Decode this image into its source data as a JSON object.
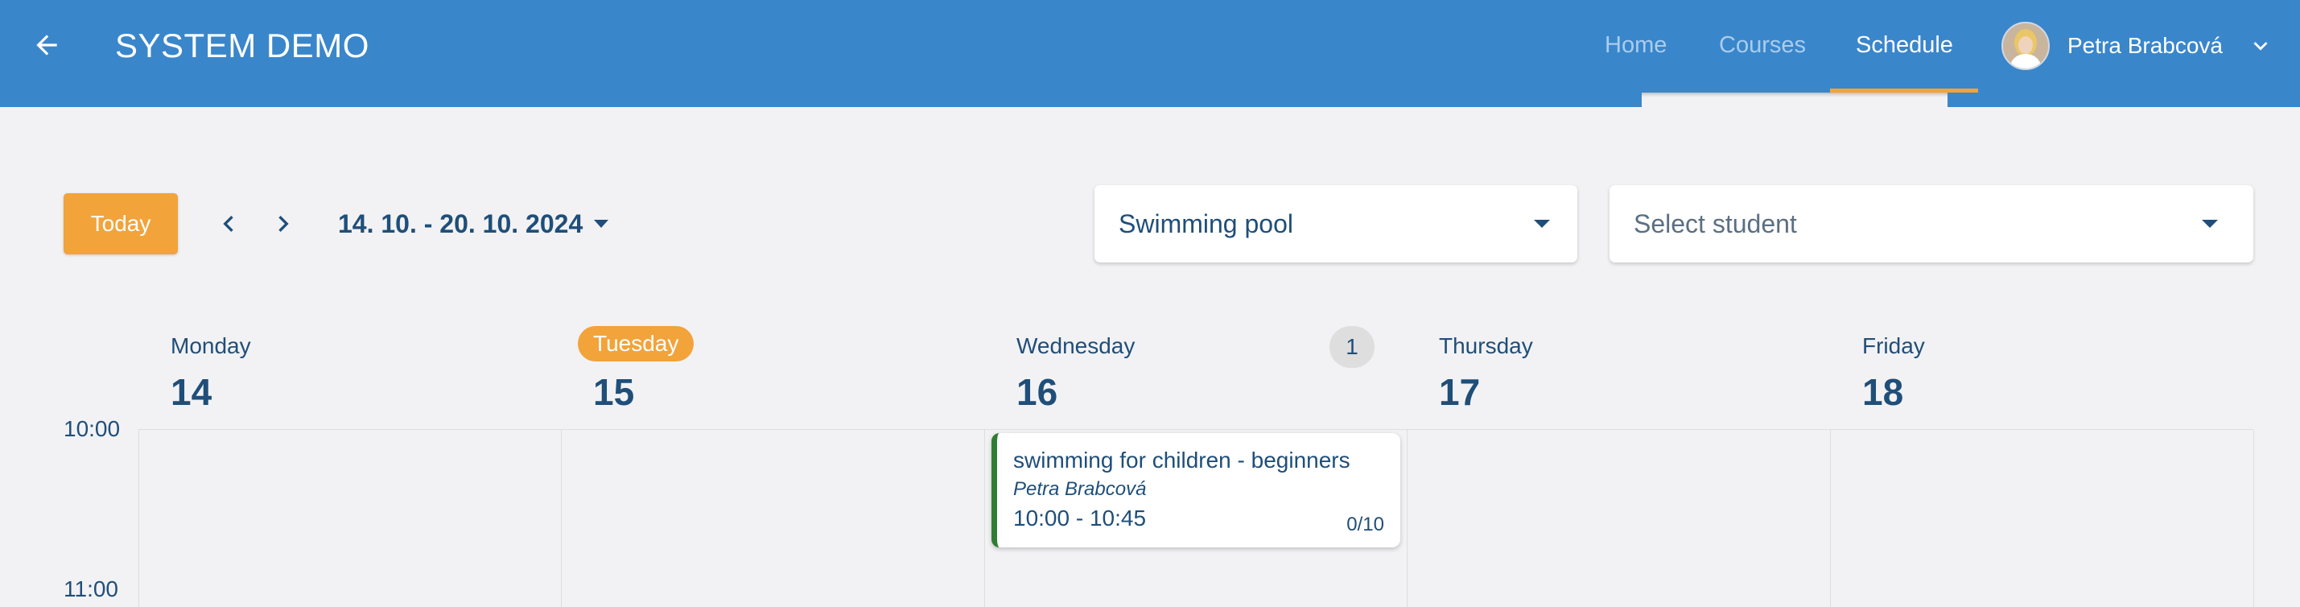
{
  "header": {
    "app_title": "SYSTEM DEMO",
    "nav": [
      {
        "label": "Home"
      },
      {
        "label": "Courses"
      },
      {
        "label": "Schedule"
      }
    ],
    "active_nav": "Schedule",
    "user_name": "Petra Brabcová"
  },
  "toolbar": {
    "today_label": "Today",
    "date_range": "14. 10. - 20. 10. 2024",
    "location_select": {
      "value": "Swimming pool"
    },
    "student_select": {
      "placeholder": "Select student"
    }
  },
  "calendar": {
    "days": [
      {
        "name": "Monday",
        "number": "14",
        "is_today": false
      },
      {
        "name": "Tuesday",
        "number": "15",
        "is_today": true
      },
      {
        "name": "Wednesday",
        "number": "16",
        "is_today": false,
        "event_count": "1"
      },
      {
        "name": "Thursday",
        "number": "17",
        "is_today": false
      },
      {
        "name": "Friday",
        "number": "18",
        "is_today": false
      }
    ],
    "hours": [
      "10:00",
      "11:00"
    ],
    "events": [
      {
        "title": "swimming for children - beginners",
        "teacher": "Petra Brabcová",
        "time": "10:00 - 10:45",
        "capacity": "0/10",
        "day": "Wednesday",
        "accent_color": "#2e7d32"
      }
    ]
  },
  "colors": {
    "primary": "#3a86cb",
    "accent": "#f2a33a",
    "text": "#1f4e79",
    "background": "#f2f2f4"
  },
  "icons": {
    "back": "arrow-left-icon",
    "prev": "chevron-left-icon",
    "next": "chevron-right-icon",
    "user_menu": "chevron-down-icon",
    "dropdown": "caret-down-icon"
  }
}
